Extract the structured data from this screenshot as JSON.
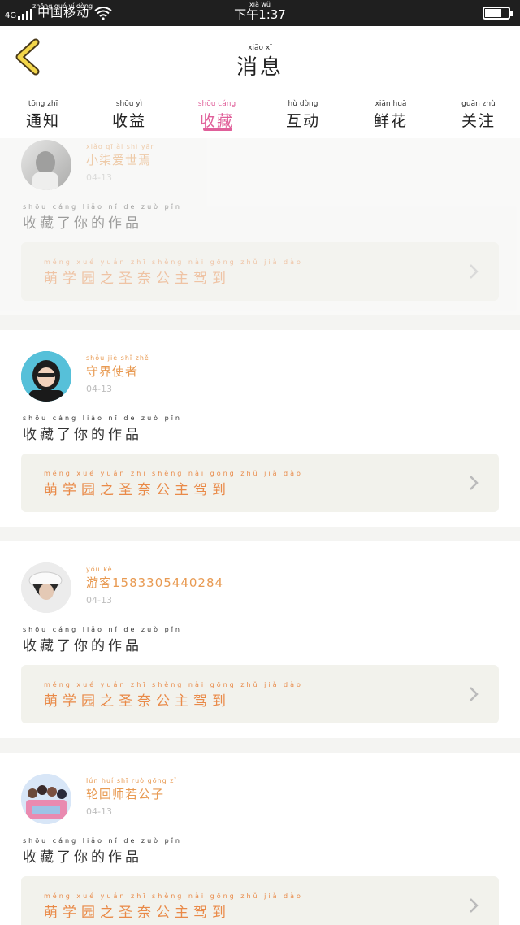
{
  "status_bar": {
    "network": "4G",
    "carrier": "中国移动",
    "carrier_pinyin": "zhōng guó yí dòng",
    "time": "下午1:37",
    "time_pinyin": "xià wǔ"
  },
  "header": {
    "title": "消息",
    "title_pinyin": "xiāo xī"
  },
  "tabs": [
    {
      "label": "通知",
      "pinyin": "tōng zhī",
      "active": false
    },
    {
      "label": "收益",
      "pinyin": "shōu yì",
      "active": false
    },
    {
      "label": "收藏",
      "pinyin": "shōu cáng",
      "active": true
    },
    {
      "label": "互动",
      "pinyin": "hù dòng",
      "active": false
    },
    {
      "label": "鲜花",
      "pinyin": "xiān huā",
      "active": false
    },
    {
      "label": "关注",
      "pinyin": "guān zhù",
      "active": false
    }
  ],
  "notifications": [
    {
      "username": "小柒爱世焉",
      "username_pinyin": "xiǎo qī ài shì yān",
      "date": "04-13",
      "action": "收藏了你的作品",
      "action_pinyin": "shōu cáng liǎo nǐ de zuò pǐn",
      "work_title": "萌学园之圣奈公主驾到",
      "work_title_pinyin": "méng xué yuán zhī shèng nài gōng zhǔ jià dào"
    },
    {
      "username": "守界使者",
      "username_pinyin": "shǒu jiè shǐ zhě",
      "date": "04-13",
      "action": "收藏了你的作品",
      "action_pinyin": "shōu cáng liǎo nǐ de zuò pǐn",
      "work_title": "萌学园之圣奈公主驾到",
      "work_title_pinyin": "méng xué yuán zhī shèng nài gōng zhǔ jià dào"
    },
    {
      "username": "游客1583305440284",
      "username_pinyin": "yóu kè",
      "date": "04-13",
      "action": "收藏了你的作品",
      "action_pinyin": "shōu cáng liǎo nǐ de zuò pǐn",
      "work_title": "萌学园之圣奈公主驾到",
      "work_title_pinyin": "méng xué yuán zhī shèng nài gōng zhǔ jià dào"
    },
    {
      "username": "轮回师若公子",
      "username_pinyin": "lún huí shī ruò gōng zǐ",
      "date": "04-13",
      "action": "收藏了你的作品",
      "action_pinyin": "shōu cáng liǎo nǐ de zuò pǐn",
      "work_title": "萌学园之圣奈公主驾到",
      "work_title_pinyin": "méng xué yuán zhī shèng nài gōng zhǔ jià dào"
    }
  ],
  "colors": {
    "accent": "#e0609a",
    "username": "#e89a52",
    "work_title": "#e98a48",
    "work_box": "#f2f2ec"
  }
}
